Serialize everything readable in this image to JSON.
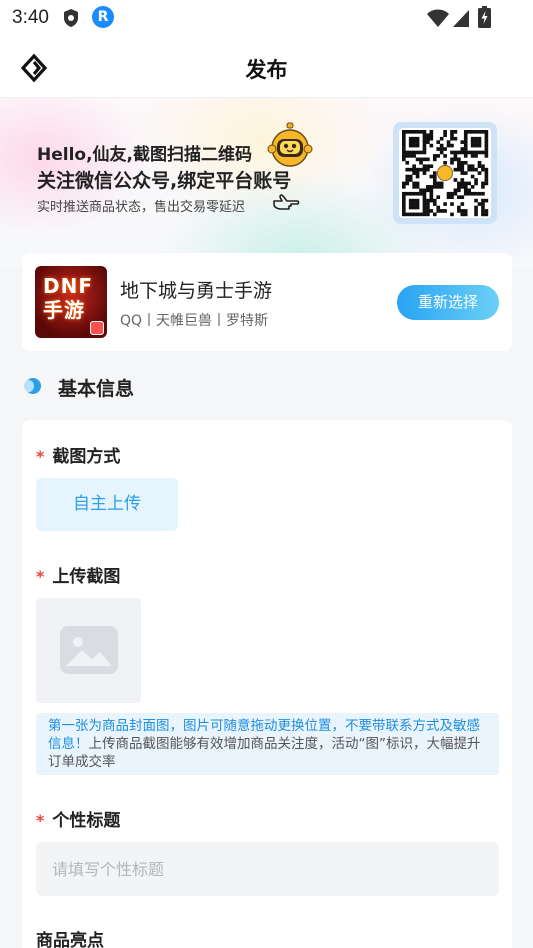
{
  "status_bar": {
    "time": "3:40",
    "app_badge": "R"
  },
  "header": {
    "title": "发布"
  },
  "banner": {
    "line1": "Hello,仙友,截图扫描二维码",
    "line2": "关注微信公众号,绑定平台账号",
    "line3": "实时推送商品状态，售出交易零延迟"
  },
  "game": {
    "logo_text_1": "DNF",
    "logo_text_2": "手游",
    "name": "地下城与勇士手游",
    "meta": "QQ丨天帷巨兽丨罗特斯",
    "reselect_label": "重新选择"
  },
  "section": {
    "title": "基本信息"
  },
  "form": {
    "required_mark": "*",
    "method_label": "截图方式",
    "method_option": "自主上传",
    "upload_label": "上传截图",
    "tip_highlight": "第一张为商品封面图，图片可随意拖动更换位置，不要带联系方式及敏感信息！",
    "tip_rest": "上传商品截图能够有效增加商品关注度，活动“图”标识，大幅提升订单成交率",
    "title_label": "个性标题",
    "title_placeholder": "请填写个性标题",
    "highlights_label": "商品亮点"
  },
  "colors": {
    "accent": "#2b9fe8",
    "required": "#e5463a",
    "button_gradient_start": "#27a4f2",
    "button_gradient_end": "#6ccff6"
  }
}
